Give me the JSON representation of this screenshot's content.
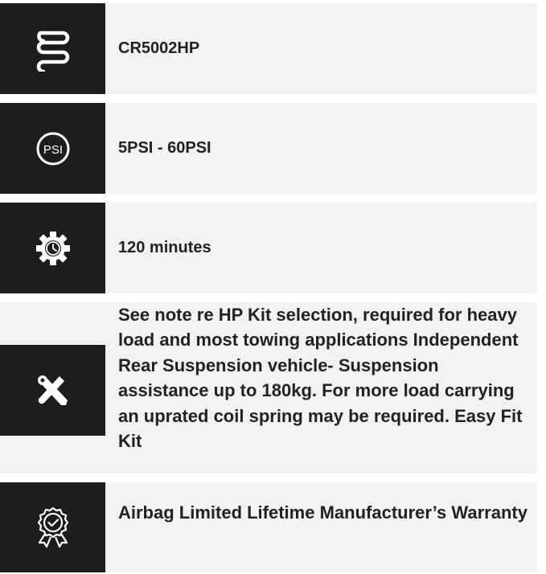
{
  "features": [
    {
      "icon": "coil-spring-icon",
      "text": "CR5002HP"
    },
    {
      "icon": "psi-gauge-icon",
      "text": "5PSI - 60PSI"
    },
    {
      "icon": "gear-clock-icon",
      "text": "120 minutes"
    },
    {
      "icon": "tools-icon",
      "text": "See note re HP Kit selection, required for heavy load and most towing applications Independent Rear Suspension vehicle- Suspension assistance up to 180kg. For more load carrying an uprated coil spring may be required. Easy Fit Kit"
    },
    {
      "icon": "warranty-badge-icon",
      "text": "Airbag Limited Lifetime Manufacturer’s Warranty"
    }
  ],
  "icon_text": {
    "psi": "PSI"
  },
  "colors": {
    "icon_bg": "#1d1d1d",
    "row_bg": "#f2f2f2",
    "text": "#222222",
    "icon_fg": "#ffffff"
  }
}
